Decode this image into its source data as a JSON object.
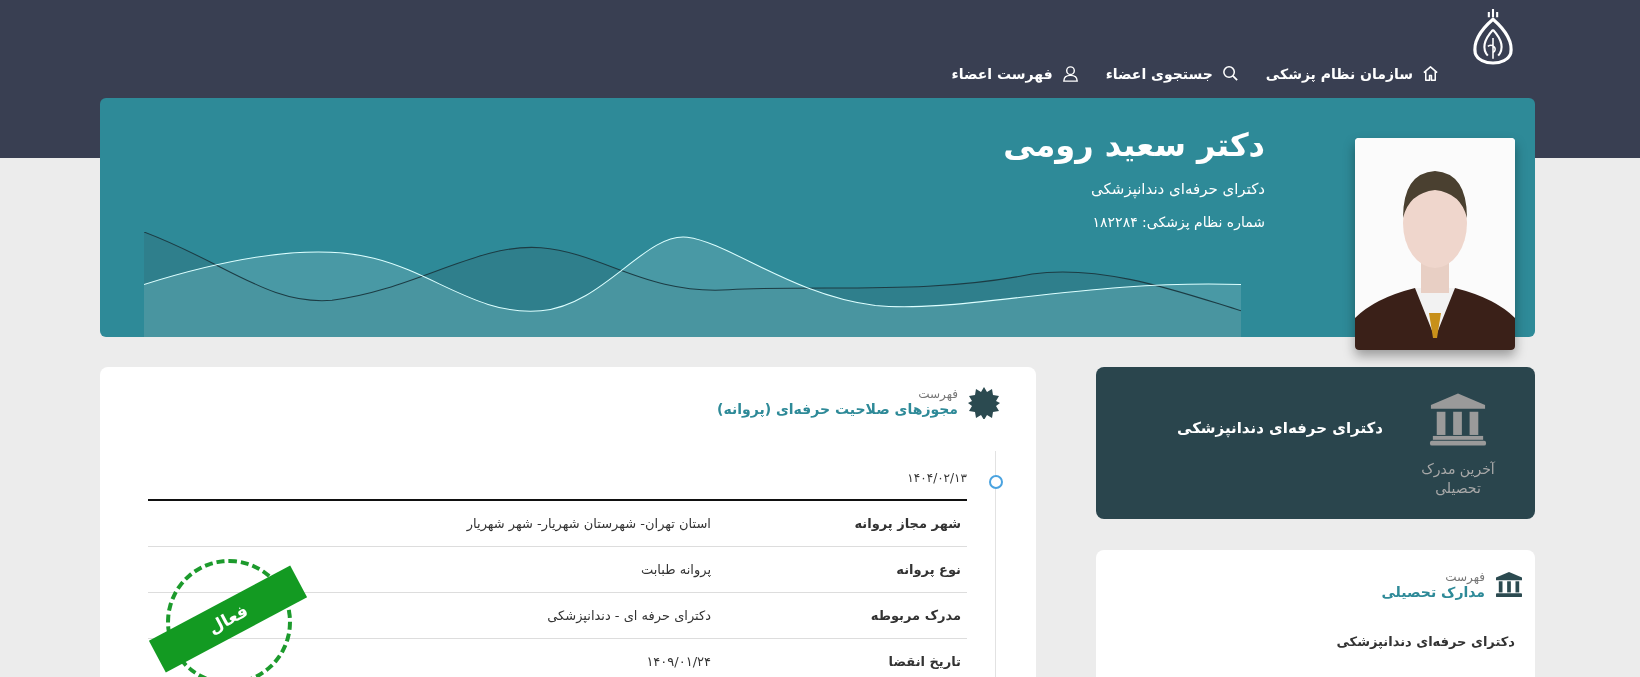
{
  "header": {
    "nav": [
      {
        "label": "سازمان نظام پزشکی"
      },
      {
        "label": "جستجوی اعضاء"
      },
      {
        "label": "فهرست اعضاء"
      }
    ]
  },
  "profile": {
    "name": "دکتر سعید رومی",
    "specialty": "دکترای حرفه‌ای دندانپزشکی",
    "number": "شماره نظام پزشکی: ۱۸۲۲۸۴"
  },
  "latest_degree": {
    "label": "آخرین مدرک تحصیلی",
    "value": "دکترای حرفه‌ای دندانپزشکی"
  },
  "degrees": {
    "caption": "فهرست",
    "title": "مدارک تحصیلی",
    "items": [
      "دکترای حرفه‌ای دندانپزشکی"
    ]
  },
  "licenses": {
    "caption": "فهرست",
    "title": "مجوزهای صلاحیت حرفه‌ای (پروانه)",
    "entries": [
      {
        "date": "۱۴۰۴/۰۲/۱۳",
        "status": "فعال",
        "fields": [
          {
            "label": "شهر مجاز پروانه",
            "value": "استان تهران- شهرستان شهریار- شهر شهریار"
          },
          {
            "label": "نوع پروانه",
            "value": "پروانه طبابت"
          },
          {
            "label": "مدرک مربوطه",
            "value": "دکترای حرفه ای - دندانپزشکی"
          },
          {
            "label": "تاریخ انقضا",
            "value": "۱۴۰۹/۰۱/۲۴"
          }
        ]
      }
    ]
  }
}
